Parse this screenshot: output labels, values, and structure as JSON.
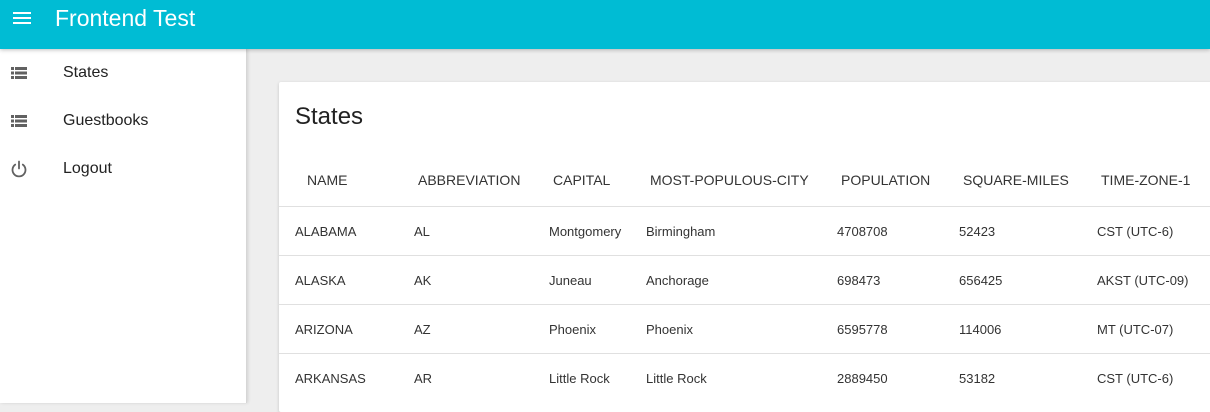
{
  "app": {
    "title": "Frontend Test"
  },
  "sidebar": {
    "items": [
      {
        "label": "States",
        "icon": "list-icon"
      },
      {
        "label": "Guestbooks",
        "icon": "list-icon"
      },
      {
        "label": "Logout",
        "icon": "power-icon"
      }
    ]
  },
  "card": {
    "title": "States"
  },
  "table": {
    "headers": [
      "NAME",
      "ABBREVIATION",
      "CAPITAL",
      "MOST-POPULOUS-CITY",
      "POPULATION",
      "SQUARE-MILES",
      "TIME-ZONE-1"
    ],
    "rows": [
      [
        "ALABAMA",
        "AL",
        "Montgomery",
        "Birmingham",
        "4708708",
        "52423",
        "CST (UTC-6)"
      ],
      [
        "ALASKA",
        "AK",
        "Juneau",
        "Anchorage",
        "698473",
        "656425",
        "AKST (UTC-09)"
      ],
      [
        "ARIZONA",
        "AZ",
        "Phoenix",
        "Phoenix",
        "6595778",
        "114006",
        "MT (UTC-07)"
      ],
      [
        "ARKANSAS",
        "AR",
        "Little Rock",
        "Little Rock",
        "2889450",
        "53182",
        "CST (UTC-6)"
      ]
    ]
  },
  "colors": {
    "appbar": "#00bcd4",
    "icon": "#616161"
  }
}
